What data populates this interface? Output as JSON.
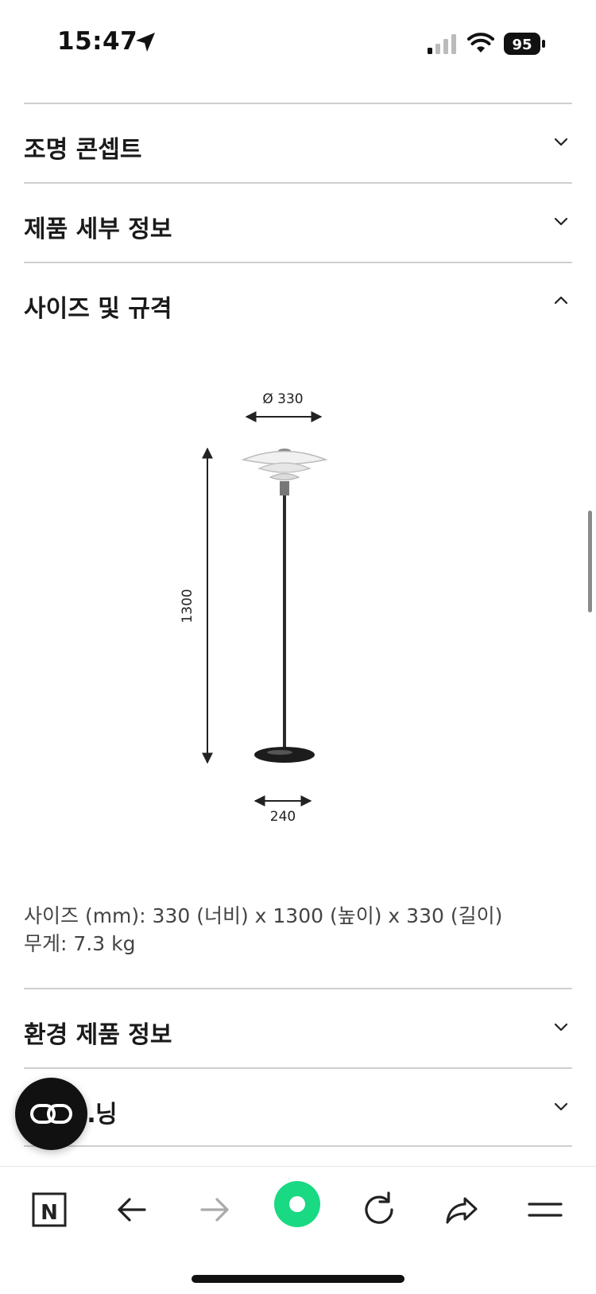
{
  "status_bar": {
    "time": "15:47",
    "battery": "95"
  },
  "accordion": {
    "items": [
      {
        "label": "조명 콘셉트",
        "expanded": false
      },
      {
        "label": "제품 세부 정보",
        "expanded": false
      },
      {
        "label": "사이즈 및 규격",
        "expanded": true
      },
      {
        "label": "환경 제품 정보",
        "expanded": false
      },
      {
        "label": "…닝",
        "expanded": false
      }
    ]
  },
  "diagram": {
    "shade_diameter": "Ø 330",
    "height": "1300",
    "base_width": "240"
  },
  "specs": {
    "size_label": "사이즈 (mm):",
    "size_value": "330 (너비) x 1300 (높이) x 330 (길이)",
    "weight_label": "무게:",
    "weight_value": "7.3 kg"
  },
  "toolbar": {
    "logo_letter": "N",
    "icons": [
      "naver-logo-icon",
      "back-arrow-icon",
      "forward-arrow-icon",
      "green-circle-icon",
      "refresh-icon",
      "share-icon",
      "menu-icon"
    ]
  },
  "colors": {
    "accent_green": "#19d983",
    "divider": "#cfcfcf"
  }
}
